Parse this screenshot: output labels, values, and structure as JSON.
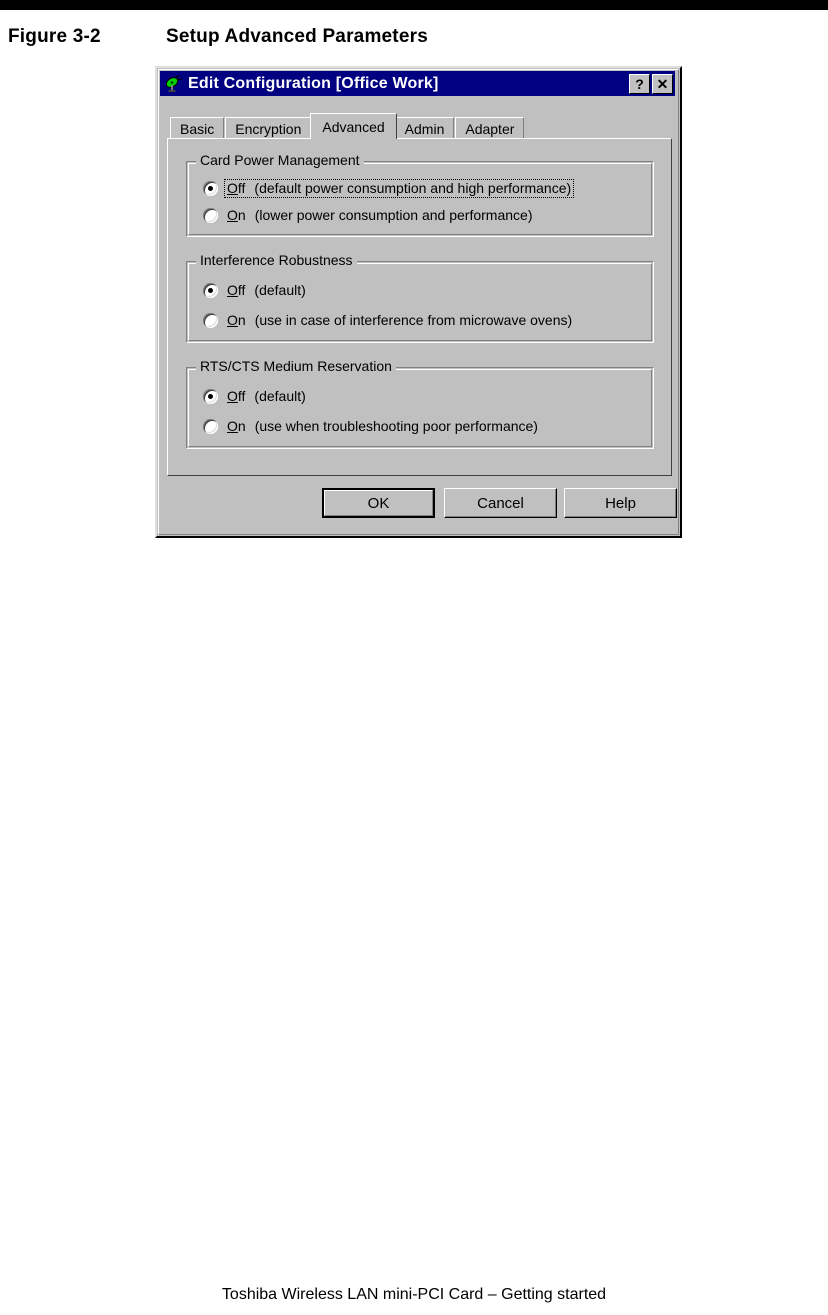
{
  "page": {
    "figure_number": "Figure 3-2",
    "figure_title": "Setup Advanced Parameters",
    "footer": "Toshiba Wireless LAN mini-PCI Card – Getting started"
  },
  "dialog": {
    "title": "Edit Configuration [Office Work]",
    "icon": "satellite-dish-icon",
    "titlebar_color": "#000080",
    "face_color": "#c0c0c0",
    "help_button": "?",
    "close_button": "✕",
    "tabs": [
      {
        "label": "Basic",
        "selected": false
      },
      {
        "label": "Encryption",
        "selected": false
      },
      {
        "label": "Advanced",
        "selected": true
      },
      {
        "label": "Admin",
        "selected": false
      },
      {
        "label": "Adapter",
        "selected": false
      }
    ],
    "groups": [
      {
        "title": "Card Power Management",
        "options": [
          {
            "accel": "O",
            "rest": "ff",
            "label": "Off",
            "desc": "(default power consumption and high performance)",
            "checked": true,
            "focused": true
          },
          {
            "accel": "O",
            "rest": "n",
            "label": "On",
            "desc": "(lower power consumption and performance)",
            "checked": false,
            "focused": false
          }
        ]
      },
      {
        "title": "Interference Robustness",
        "options": [
          {
            "accel": "O",
            "rest": "ff",
            "label": "Off",
            "desc": "(default)",
            "checked": true,
            "focused": false
          },
          {
            "accel": "O",
            "rest": "n",
            "label": "On",
            "desc": "(use in case of interference from microwave ovens)",
            "checked": false,
            "focused": false
          }
        ]
      },
      {
        "title": "RTS/CTS Medium Reservation",
        "options": [
          {
            "accel": "O",
            "rest": "ff",
            "label": "Off",
            "desc": "(default)",
            "checked": true,
            "focused": false
          },
          {
            "accel": "O",
            "rest": "n",
            "label": "On",
            "desc": "(use when troubleshooting poor performance)",
            "checked": false,
            "focused": false
          }
        ]
      }
    ],
    "buttons": [
      {
        "label": "OK",
        "default": true
      },
      {
        "label": "Cancel",
        "default": false
      },
      {
        "label": "Help",
        "default": false
      }
    ]
  }
}
